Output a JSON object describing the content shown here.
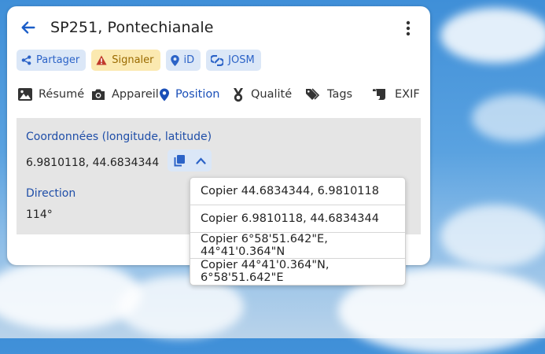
{
  "header": {
    "title": "SP251, Pontechianale"
  },
  "badges": [
    {
      "label": "Partager",
      "icon": "share-icon"
    },
    {
      "label": "Signaler",
      "icon": "warning-icon"
    },
    {
      "label": "iD",
      "icon": "map-pin-icon"
    },
    {
      "label": "JOSM",
      "icon": "link-icon"
    }
  ],
  "tabs": [
    {
      "label": "Résumé",
      "icon": "image-icon"
    },
    {
      "label": "Appareil",
      "icon": "camera-icon"
    },
    {
      "label": "Position",
      "icon": "map-pin-icon",
      "active": true
    },
    {
      "label": "Qualité",
      "icon": "medal-icon"
    },
    {
      "label": "Tags",
      "icon": "tags-icon"
    },
    {
      "label": "EXIF",
      "icon": "scroll-icon"
    }
  ],
  "position": {
    "coords_label": "Coordonnées (longitude, latitude)",
    "coords_value": "6.9810118, 44.6834344",
    "direction_label": "Direction",
    "direction_value": "114°"
  },
  "copy_menu": [
    {
      "label": "Copier 44.6834344, 6.9810118"
    },
    {
      "label": "Copier 6.9810118, 44.6834344"
    },
    {
      "label": "Copier 6°58'51.642\"E, 44°41'0.364\"N"
    },
    {
      "label": "Copier 44°41'0.364\"N, 6°58'51.642\"E"
    }
  ],
  "colors": {
    "accent": "#1a4fb8",
    "badge_blue_bg": "#dbe7f7",
    "badge_yellow_bg": "#fbe9b0",
    "content_bg": "#e5e5e5"
  }
}
